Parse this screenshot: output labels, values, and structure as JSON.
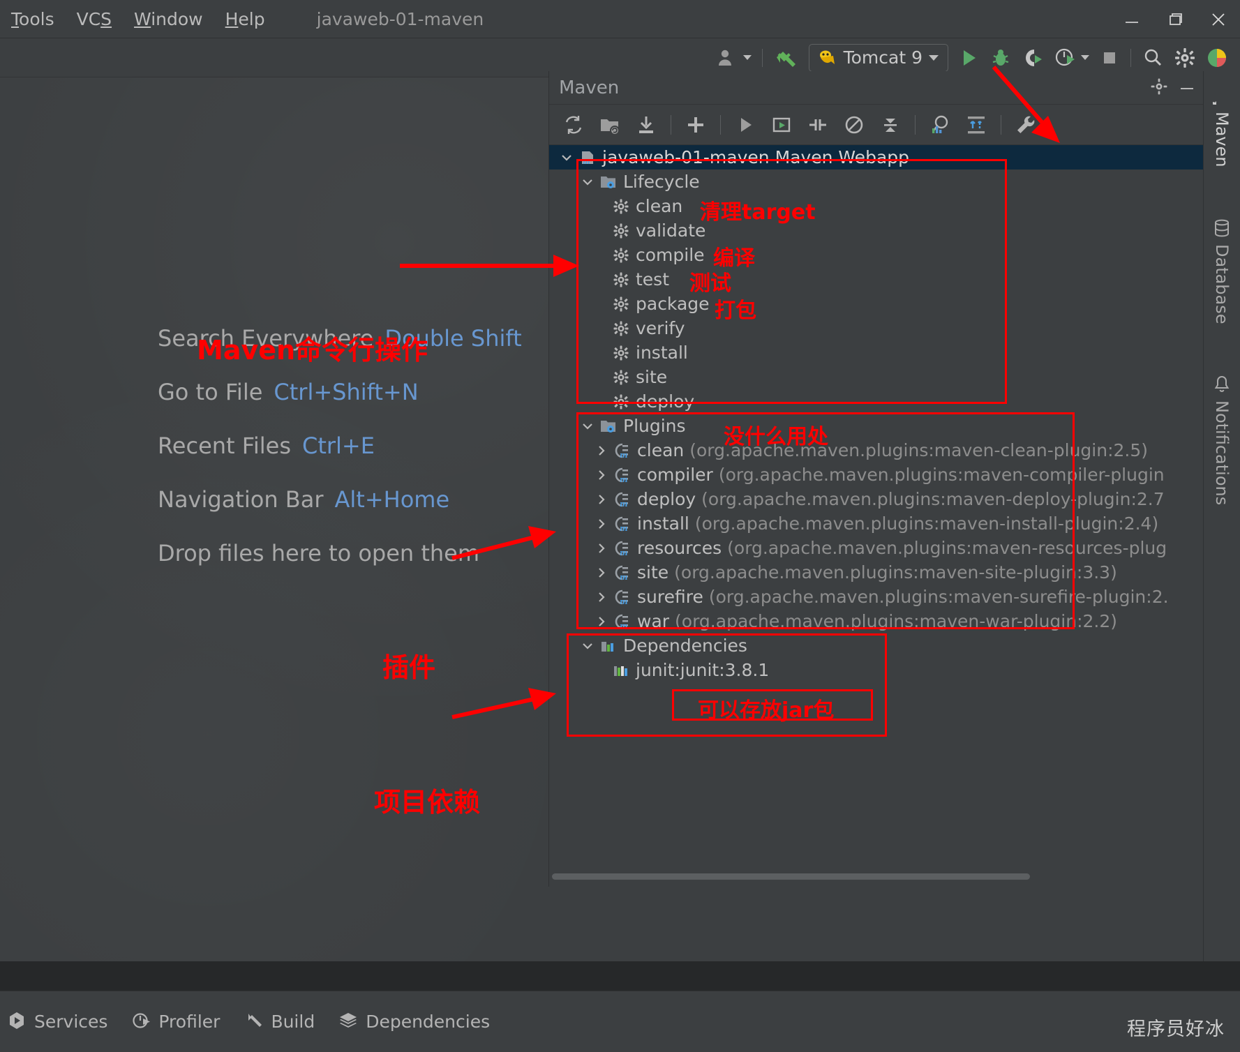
{
  "window": {
    "title": "javaweb-01-maven",
    "menus": [
      {
        "label": "Tools",
        "mnemonic": "T"
      },
      {
        "label": "VCS",
        "mnemonic": "S"
      },
      {
        "label": "Window",
        "mnemonic": "W"
      },
      {
        "label": "Help",
        "mnemonic": "H"
      }
    ],
    "controls": {
      "minimize": "minimize-icon",
      "maximize": "maximize-icon",
      "close": "close-icon"
    }
  },
  "toolbar": {
    "user_icon": "user-avatar-icon",
    "vcs_update_icon": "vcs-update-icon",
    "run_configuration": "Tomcat 9",
    "run_icon": "run-icon",
    "debug_icon": "debug-icon",
    "run_with_coverage_icon": "run-coverage-icon",
    "profiler_icon": "profiler-icon",
    "stop_icon": "stop-icon",
    "search_icon": "search-icon",
    "settings_icon": "settings-gear-icon",
    "updates_icon": "idea-logo-icon"
  },
  "editor_hints": [
    {
      "label": "Search Everywhere",
      "key": "Double Shift"
    },
    {
      "label": "Go to File",
      "key": "Ctrl+Shift+N"
    },
    {
      "label": "Recent Files",
      "key": "Ctrl+E"
    },
    {
      "label": "Navigation Bar",
      "key": "Alt+Home"
    },
    {
      "label": "Drop files here to open them",
      "key": ""
    }
  ],
  "maven_panel": {
    "title": "Maven",
    "header_actions": [
      {
        "name": "settings-gear-icon"
      },
      {
        "name": "hide-icon"
      }
    ],
    "toolbar_icons": [
      {
        "name": "reload-all-maven-projects-icon"
      },
      {
        "name": "add-maven-project-icon"
      },
      {
        "name": "download-sources-icon"
      },
      {
        "name": "add-icon"
      },
      {
        "name": "run-icon"
      },
      {
        "name": "execute-maven-goal-icon"
      },
      {
        "name": "toggle-skip-tests-icon"
      },
      {
        "name": "toggle-offline-mode-icon"
      },
      {
        "name": "collapse-all-icon"
      },
      {
        "name": "dependency-analyzer-icon"
      },
      {
        "name": "show-dependencies-icon"
      },
      {
        "name": "maven-settings-wrench-icon"
      }
    ],
    "tree": {
      "root": {
        "label": "javaweb-01-maven Maven Webapp",
        "icon": "maven-project-icon",
        "expanded": true
      },
      "lifecycle": {
        "label": "Lifecycle",
        "icon": "lifecycle-folder-icon",
        "expanded": true,
        "goals": [
          {
            "label": "clean"
          },
          {
            "label": "validate"
          },
          {
            "label": "compile"
          },
          {
            "label": "test"
          },
          {
            "label": "package"
          },
          {
            "label": "verify"
          },
          {
            "label": "install"
          },
          {
            "label": "site"
          },
          {
            "label": "deploy"
          }
        ]
      },
      "plugins": {
        "label": "Plugins",
        "icon": "plugins-folder-icon",
        "expanded": true,
        "items": [
          {
            "name": "clean",
            "coordinates": "(org.apache.maven.plugins:maven-clean-plugin:2.5)"
          },
          {
            "name": "compiler",
            "coordinates": "(org.apache.maven.plugins:maven-compiler-plugin"
          },
          {
            "name": "deploy",
            "coordinates": "(org.apache.maven.plugins:maven-deploy-plugin:2.7"
          },
          {
            "name": "install",
            "coordinates": "(org.apache.maven.plugins:maven-install-plugin:2.4)"
          },
          {
            "name": "resources",
            "coordinates": "(org.apache.maven.plugins:maven-resources-plug"
          },
          {
            "name": "site",
            "coordinates": "(org.apache.maven.plugins:maven-site-plugin:3.3)"
          },
          {
            "name": "surefire",
            "coordinates": "(org.apache.maven.plugins:maven-surefire-plugin:2."
          },
          {
            "name": "war",
            "coordinates": "(org.apache.maven.plugins:maven-war-plugin:2.2)"
          }
        ]
      },
      "dependencies": {
        "label": "Dependencies",
        "icon": "dependencies-icon",
        "expanded": true,
        "items": [
          {
            "label": "junit:junit:3.8.1",
            "icon": "dependency-bar-icon"
          }
        ]
      }
    }
  },
  "annotations": {
    "lifecycle_title": "Maven命令行操作",
    "clean": "清理target",
    "compile": "编译",
    "test": "测试",
    "package": "打包",
    "plugins_note": "没什么用处",
    "plugins_title": "插件",
    "dependencies_title": "项目依赖",
    "jar_note": "可以存放jar包",
    "color": "#ff0000"
  },
  "right_strip": {
    "tabs": [
      {
        "label": "Maven",
        "icon": "maven-m-icon",
        "active": true
      },
      {
        "label": "Database",
        "icon": "database-icon",
        "active": false
      },
      {
        "label": "Notifications",
        "icon": "notifications-bell-icon",
        "active": false
      }
    ]
  },
  "statusbar": {
    "items": [
      {
        "label": "Services",
        "icon": "services-icon"
      },
      {
        "label": "Profiler",
        "icon": "profiler-icon"
      },
      {
        "label": "Build",
        "icon": "build-hammer-icon"
      },
      {
        "label": "Dependencies",
        "icon": "dependencies-layers-icon"
      }
    ],
    "watermark": "程序员好冰"
  }
}
